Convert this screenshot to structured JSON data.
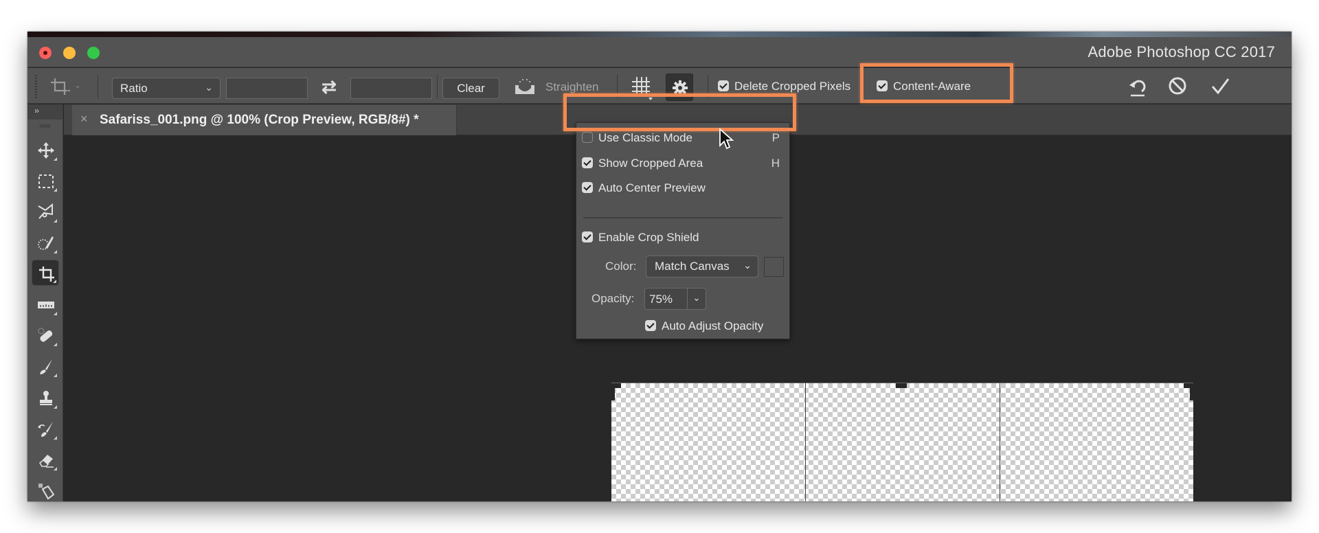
{
  "window": {
    "app_title": "Adobe Photoshop CC 2017",
    "traffic_lights": [
      "close",
      "minimize",
      "zoom"
    ]
  },
  "options_bar": {
    "tool_preset_icon": "crop-icon",
    "ratio_select": {
      "value": "Ratio"
    },
    "width_field": {
      "value": ""
    },
    "height_field": {
      "value": ""
    },
    "swap_icon": "swap-arrows-icon",
    "clear_label": "Clear",
    "straighten_label": "Straighten",
    "overlay_icon": "grid-overlay-icon",
    "settings_icon": "gear-icon",
    "delete_cropped_pixels": {
      "label": "Delete Cropped Pixels",
      "checked": true
    },
    "content_aware": {
      "label": "Content-Aware",
      "checked": true
    },
    "commit_icons": [
      "reset-icon",
      "cancel-icon",
      "commit-checkmark-icon"
    ]
  },
  "toolbox": {
    "collapse_label": "››",
    "tools": [
      {
        "name": "move-tool",
        "active": false
      },
      {
        "name": "marquee-tool",
        "active": false
      },
      {
        "name": "polygonal-lasso-tool",
        "active": false
      },
      {
        "name": "quick-selection-tool",
        "active": false
      },
      {
        "name": "crop-tool",
        "active": true
      },
      {
        "name": "ruler-tool",
        "active": false
      },
      {
        "name": "spot-healing-tool",
        "active": false
      },
      {
        "name": "brush-tool",
        "active": false
      },
      {
        "name": "clone-stamp-tool",
        "active": false
      },
      {
        "name": "history-brush-tool",
        "active": false
      },
      {
        "name": "eraser-tool",
        "active": false
      },
      {
        "name": "gradient-tool",
        "active": false
      }
    ]
  },
  "document_tab": {
    "close_label": "×",
    "title": "Safariss_001.png @ 100% (Crop Preview, RGB/8#) *"
  },
  "crop_settings_popup": {
    "items": [
      {
        "label": "Use Classic Mode",
        "checked": false,
        "shortcut": "P"
      },
      {
        "label": "Show Cropped Area",
        "checked": true,
        "shortcut": "H"
      },
      {
        "label": "Auto Center Preview",
        "checked": true,
        "shortcut": ""
      },
      {
        "label": "Enable Crop Shield",
        "checked": true,
        "shortcut": ""
      }
    ],
    "color_label": "Color:",
    "color_value": "Match Canvas",
    "opacity_label": "Opacity:",
    "opacity_value": "75%",
    "auto_adjust_opacity": {
      "label": "Auto Adjust Opacity",
      "checked": true
    }
  },
  "annotations": {
    "highlight_color": "#f28a52",
    "highlighted": [
      "Use Classic Mode",
      "Content-Aware"
    ]
  }
}
